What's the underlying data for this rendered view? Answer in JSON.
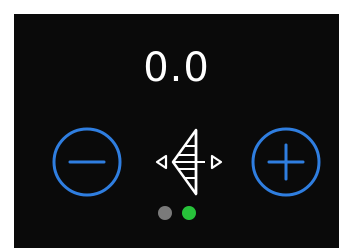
{
  "readout": {
    "value": "0.0"
  },
  "controls": {
    "decrease_icon": "minus-circle-icon",
    "increase_icon": "plus-circle-icon",
    "mode_icon": "trim-tab-icon",
    "accent_color": "#2f7ee0"
  },
  "page_indicator": {
    "dots": [
      {
        "color": "#7a7a7a",
        "active": false
      },
      {
        "color": "#27c23a",
        "active": true
      }
    ]
  }
}
